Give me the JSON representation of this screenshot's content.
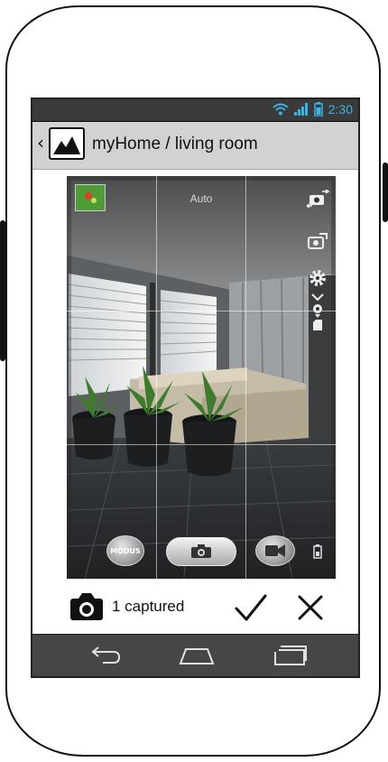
{
  "status_bar": {
    "time": "2:30",
    "icons": [
      "wifi-icon",
      "signal-icon",
      "battery-icon"
    ],
    "time_color": "#39b5e5"
  },
  "app_bar": {
    "back_icon": "chevron-left-icon",
    "logo_icon": "mountain-image-icon",
    "title": "myHome / living room"
  },
  "camera": {
    "flash_mode": "Auto",
    "thumbnail_icon": "last-photo-thumbnail",
    "side_controls": [
      "switch-camera-icon",
      "camera-settings-icon",
      "gear-icon",
      "location-icon",
      "sd-card-icon"
    ],
    "mode_button_label": "MODUS",
    "shutter_icon": "camera-icon",
    "video_icon": "video-camera-icon",
    "storage_icon": "storage-icon"
  },
  "actions": {
    "captured_icon": "camera-icon",
    "captured_text": "1 captured",
    "confirm_icon": "checkmark-icon",
    "cancel_icon": "close-icon"
  },
  "nav_bar": {
    "buttons": [
      "back-icon",
      "home-icon",
      "recent-apps-icon"
    ]
  }
}
